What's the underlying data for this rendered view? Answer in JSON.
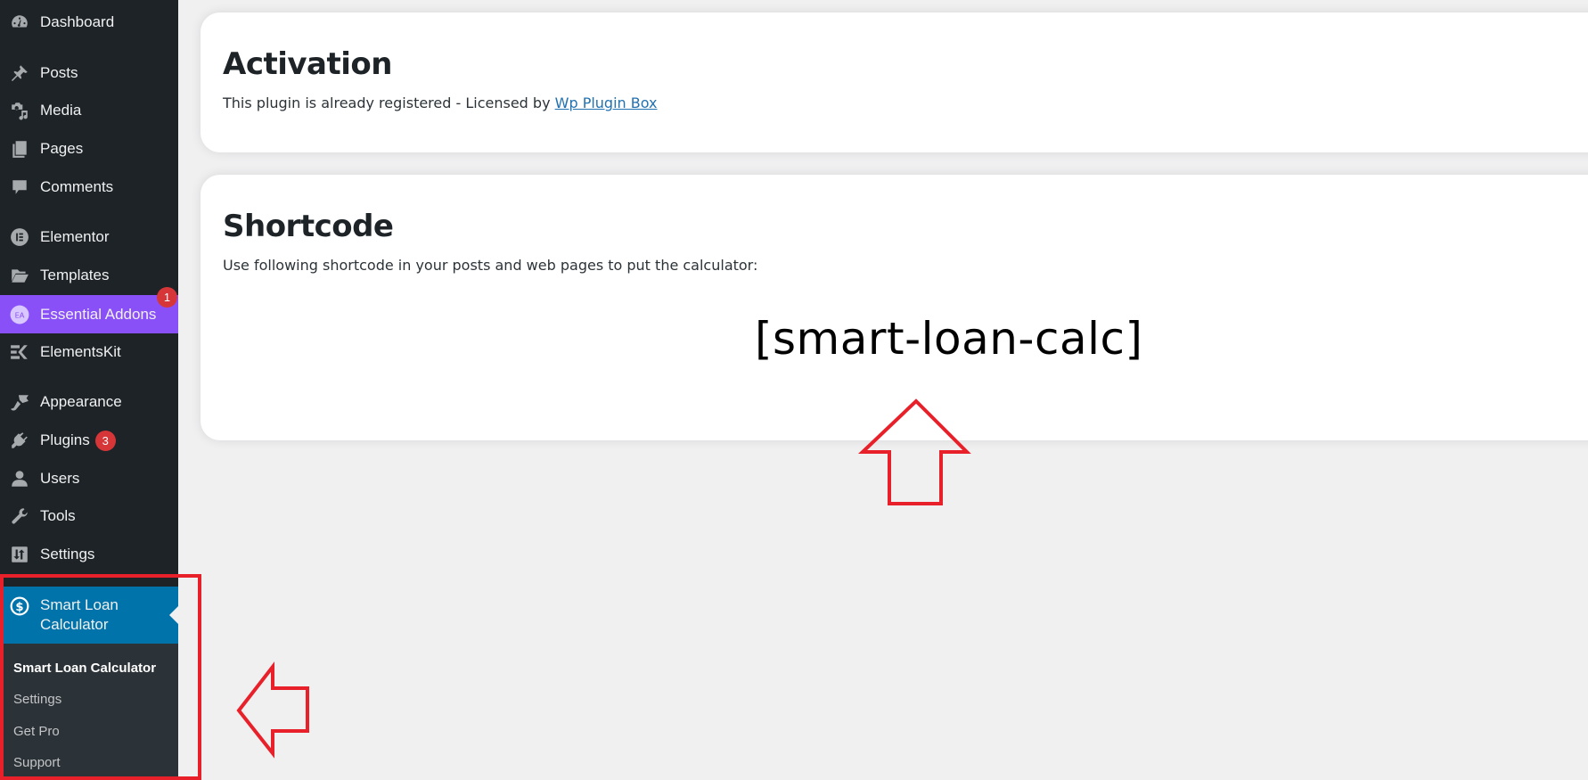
{
  "sidebar": {
    "items": [
      {
        "label": "Dashboard",
        "icon": "dashboard-icon"
      },
      {
        "label": "Posts",
        "icon": "pin-icon"
      },
      {
        "label": "Media",
        "icon": "media-icon"
      },
      {
        "label": "Pages",
        "icon": "pages-icon"
      },
      {
        "label": "Comments",
        "icon": "comment-icon"
      },
      {
        "label": "Elementor",
        "icon": "elementor-icon"
      },
      {
        "label": "Templates",
        "icon": "folder-icon"
      },
      {
        "label": "Essential Addons",
        "icon": "essential-addons-icon",
        "badge": "1",
        "highlight_color": "#8a50f8"
      },
      {
        "label": "ElementsKit",
        "icon": "elementskit-icon"
      },
      {
        "label": "Appearance",
        "icon": "brush-icon"
      },
      {
        "label": "Plugins",
        "icon": "plug-icon",
        "badge": "3"
      },
      {
        "label": "Users",
        "icon": "user-icon"
      },
      {
        "label": "Tools",
        "icon": "wrench-icon"
      },
      {
        "label": "Settings",
        "icon": "settings-icon"
      },
      {
        "label": "Smart Loan Calculator",
        "icon": "dollar-icon",
        "active": true,
        "active_color": "#0073aa"
      }
    ],
    "submenu": [
      {
        "label": "Smart Loan Calculator",
        "active": true
      },
      {
        "label": "Settings"
      },
      {
        "label": "Get Pro"
      },
      {
        "label": "Support"
      }
    ]
  },
  "activation": {
    "title": "Activation",
    "text": "This plugin is already registered - Licensed by ",
    "link_label": "Wp Plugin Box"
  },
  "shortcode": {
    "title": "Shortcode",
    "text": "Use following shortcode in your posts and web pages to put the calculator:",
    "code": "[smart-loan-calc]"
  },
  "annotations": {
    "color": "#e8202a",
    "items": [
      "highlight-box around Smart Loan Calculator menu",
      "left-arrow pointing to menu",
      "up-arrow pointing to shortcode"
    ]
  }
}
